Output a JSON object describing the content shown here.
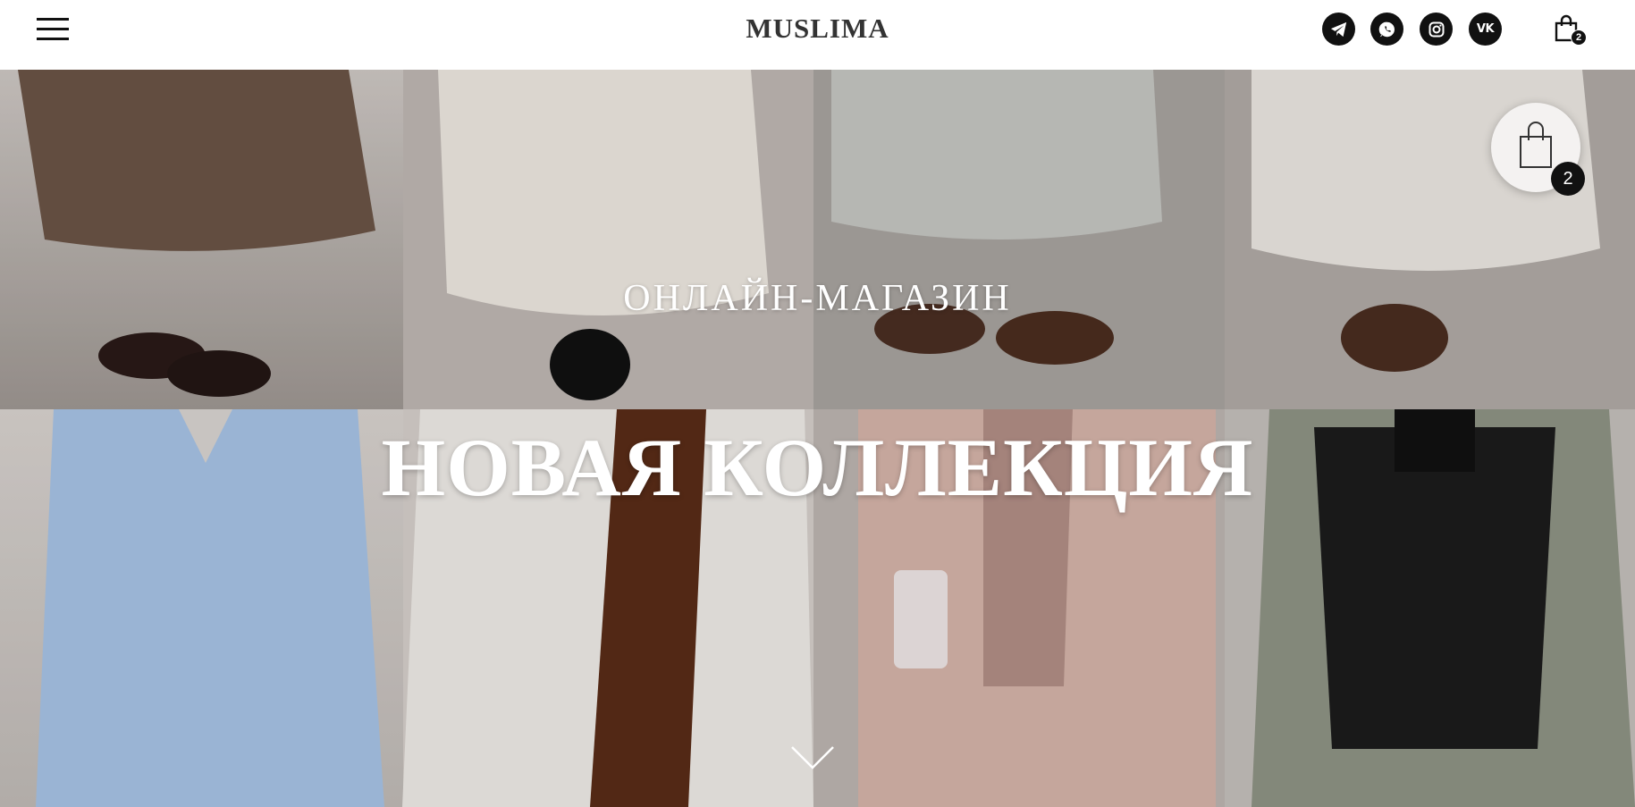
{
  "header": {
    "brand": "MUSLIMA",
    "cart_count": "2"
  },
  "social": [
    {
      "name": "telegram-icon"
    },
    {
      "name": "whatsapp-icon"
    },
    {
      "name": "instagram-icon"
    },
    {
      "name": "vk-icon",
      "label": "VK"
    }
  ],
  "hero": {
    "subtitle": "ОНЛАЙН-МАГАЗИН",
    "title": "НОВАЯ КОЛЛЕКЦИЯ"
  },
  "floating_cart": {
    "count": "2"
  },
  "colors": {
    "icon_bg": "#111111",
    "text_light": "#ffffff"
  }
}
